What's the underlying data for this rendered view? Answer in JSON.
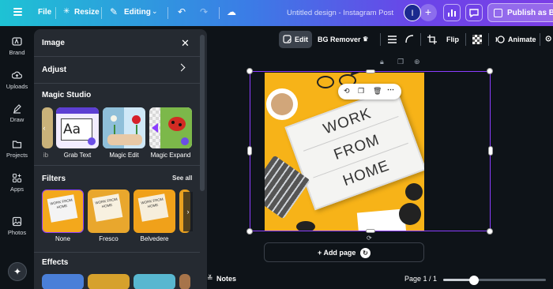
{
  "topbar": {
    "file_label": "File",
    "resize_label": "Resize",
    "editing_label": "Editing",
    "title": "Untitled design - Instagram Post",
    "avatar_initial": "I",
    "add_label": "+",
    "publish_label": "Publish as Bra"
  },
  "rail": {
    "items": [
      {
        "label": "Brand",
        "icon": "brand-icon"
      },
      {
        "label": "Uploads",
        "icon": "cloud-upload-icon"
      },
      {
        "label": "Draw",
        "icon": "pen-icon"
      },
      {
        "label": "Projects",
        "icon": "folder-icon"
      },
      {
        "label": "Apps",
        "icon": "apps-icon"
      },
      {
        "label": "Photos",
        "icon": "photo-icon"
      }
    ]
  },
  "panel": {
    "title": "Image",
    "adjust_label": "Adjust",
    "magic_studio_label": "Magic Studio",
    "magic_tools": [
      {
        "label": "ib"
      },
      {
        "label": "Grab Text"
      },
      {
        "label": "Magic Edit"
      },
      {
        "label": "Magic Expand"
      }
    ],
    "grab_text_sample": "Aa",
    "filters_label": "Filters",
    "see_all_label": "See all",
    "filters": [
      {
        "label": "None",
        "thumb_text": "WORK FROM HOME"
      },
      {
        "label": "Fresco",
        "thumb_text": "WORK FROM HOME"
      },
      {
        "label": "Belvedere",
        "thumb_text": "WORK FROM HOME"
      }
    ],
    "effects_label": "Effects"
  },
  "context_toolbar": {
    "edit_label": "Edit",
    "bg_remover_label": "BG Remover",
    "flip_label": "Flip",
    "animate_label": "Animate"
  },
  "design": {
    "lines": [
      "WORK",
      "FROM",
      "HOME"
    ]
  },
  "canvas": {
    "add_page_label": "+ Add page"
  },
  "bottom": {
    "notes_label": "Notes",
    "page_info": "Page 1 / 1",
    "zoom_fraction": 0.3
  },
  "colors": {
    "accent": "#8b3dff",
    "background": "#0e1318",
    "panel": "#252a31",
    "design_bg": "#f7b318"
  }
}
